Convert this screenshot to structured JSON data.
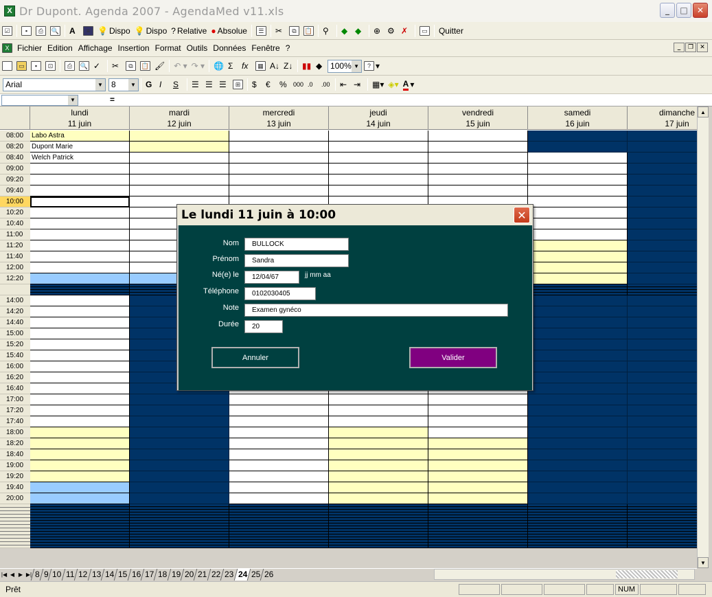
{
  "window": {
    "title": "Dr Dupont. Agenda 2007 - AgendaMed v11.xls"
  },
  "toolbar1": {
    "dispo1": "Dispo",
    "dispo2": "Dispo",
    "relative": "Relative",
    "absolue": "Absolue",
    "quitter": "Quitter"
  },
  "menu": {
    "fichier": "Fichier",
    "edition": "Edition",
    "affichage": "Affichage",
    "insertion": "Insertion",
    "format": "Format",
    "outils": "Outils",
    "donnees": "Données",
    "fenetre": "Fenêtre",
    "aide": "?"
  },
  "toolbar2": {
    "zoom": "100%"
  },
  "toolbar3": {
    "font": "Arial",
    "size": "8",
    "bold": "G",
    "italic": "I",
    "underline": "S",
    "euro": "€",
    "percent": "%",
    "thousands": "000"
  },
  "formula": {
    "eq": "="
  },
  "days": [
    {
      "name": "lundi",
      "date": "11 juin"
    },
    {
      "name": "mardi",
      "date": "12 juin"
    },
    {
      "name": "mercredi",
      "date": "13 juin"
    },
    {
      "name": "jeudi",
      "date": "14 juin"
    },
    {
      "name": "vendredi",
      "date": "15 juin"
    },
    {
      "name": "samedi",
      "date": "16 juin"
    },
    {
      "name": "dimanche",
      "date": "17 juin"
    }
  ],
  "times": [
    "08:00",
    "08:20",
    "08:40",
    "09:00",
    "09:20",
    "09:40",
    "10:00",
    "10:20",
    "10:40",
    "11:00",
    "11:20",
    "11:40",
    "12:00",
    "12:20",
    "",
    "14:00",
    "14:20",
    "14:40",
    "15:00",
    "15:20",
    "15:40",
    "16:00",
    "16:20",
    "16:40",
    "17:00",
    "17:20",
    "17:40",
    "18:00",
    "18:20",
    "18:40",
    "19:00",
    "19:20",
    "19:40",
    "20:00"
  ],
  "appointments": {
    "a0800": "Labo Astra",
    "a0820": "Dupont Marie",
    "a0840": "Welch Patrick"
  },
  "sheets": [
    "8",
    "9",
    "10",
    "11",
    "12",
    "13",
    "14",
    "15",
    "16",
    "17",
    "18",
    "19",
    "20",
    "21",
    "22",
    "23",
    "24",
    "25",
    "26"
  ],
  "active_sheet": "24",
  "status": {
    "text": "Prêt",
    "num": "NUM"
  },
  "dialog": {
    "title": "Le lundi 11 juin à 10:00",
    "labels": {
      "nom": "Nom",
      "prenom": "Prénom",
      "ne": "Né(e) le",
      "telephone": "Téléphone",
      "note": "Note",
      "duree": "Durée"
    },
    "values": {
      "nom": "BULLOCK",
      "prenom": "Sandra",
      "ne": "12/04/67",
      "telephone": "0102030405",
      "note": "Examen gynéco",
      "duree": "20"
    },
    "date_format": "jj mm aa",
    "annuler": "Annuler",
    "valider": "Valider"
  }
}
